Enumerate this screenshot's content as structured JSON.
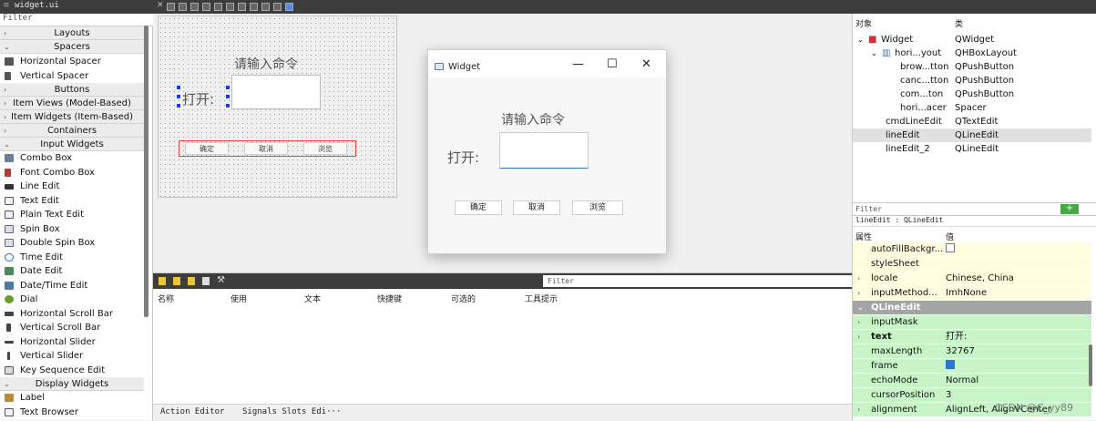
{
  "topbar": {
    "file": "widget.ui"
  },
  "left": {
    "filter": "Filter",
    "categories": {
      "layouts": "Layouts",
      "spacers": "Spacers",
      "buttons": "Buttons",
      "item_views": "Item Views (Model-Based)",
      "item_widgets": "Item Widgets (Item-Based)",
      "containers": "Containers",
      "input_widgets": "Input Widgets",
      "display_widgets": "Display Widgets"
    },
    "spacers": [
      "Horizontal Spacer",
      "Vertical Spacer"
    ],
    "input": [
      "Combo Box",
      "Font Combo Box",
      "Line Edit",
      "Text Edit",
      "Plain Text Edit",
      "Spin Box",
      "Double Spin Box",
      "Time Edit",
      "Date Edit",
      "Date/Time Edit",
      "Dial",
      "Horizontal Scroll Bar",
      "Vertical Scroll Bar",
      "Horizontal Slider",
      "Vertical Slider",
      "Key Sequence Edit"
    ],
    "display": [
      "Label",
      "Text Browser"
    ]
  },
  "form": {
    "title": "请输入命令",
    "label": "打开:",
    "buttons": [
      "确定",
      "取消",
      "浏览"
    ]
  },
  "preview": {
    "window_title": "Widget",
    "min": "—",
    "max": "☐",
    "close": "✕",
    "title": "请输入命令",
    "label": "打开:",
    "buttons": [
      "确定",
      "取消",
      "浏览"
    ]
  },
  "bottom": {
    "filter": "Filter",
    "columns": [
      "名称",
      "使用",
      "文本",
      "快捷键",
      "可选的",
      "工具提示"
    ],
    "tabs": [
      "Action Editor",
      "Signals Slots Edi···"
    ]
  },
  "object_inspector": {
    "headers": {
      "object": "对象",
      "class": "类"
    },
    "rows": [
      {
        "name": "Widget",
        "class": "QWidget"
      },
      {
        "name": "hori...yout",
        "class": "QHBoxLayout"
      },
      {
        "name": "brow...tton",
        "class": "QPushButton"
      },
      {
        "name": "canc...tton",
        "class": "QPushButton"
      },
      {
        "name": "com...ton",
        "class": "QPushButton"
      },
      {
        "name": "hori...acer",
        "class": "Spacer"
      },
      {
        "name": "cmdLineEdit",
        "class": "QTextEdit"
      },
      {
        "name": "lineEdit",
        "class": "QLineEdit"
      },
      {
        "name": "lineEdit_2",
        "class": "QLineEdit"
      }
    ]
  },
  "property_editor": {
    "filter": "Filter",
    "subtitle": "lineEdit : QLineEdit",
    "headers": {
      "property": "属性",
      "value": "值"
    },
    "rows": [
      {
        "name": "autoFillBackgr...",
        "value": "",
        "kind": "check"
      },
      {
        "name": "styleSheet",
        "value": ""
      },
      {
        "name": "locale",
        "value": "Chinese, China"
      },
      {
        "name": "inputMethod...",
        "value": "ImhNone"
      },
      {
        "name": "QLineEdit",
        "value": ""
      },
      {
        "name": "inputMask",
        "value": ""
      },
      {
        "name": "text",
        "value": "打开:"
      },
      {
        "name": "maxLength",
        "value": "32767"
      },
      {
        "name": "frame",
        "value": "",
        "kind": "checked"
      },
      {
        "name": "echoMode",
        "value": "Normal"
      },
      {
        "name": "cursorPosition",
        "value": "3"
      },
      {
        "name": "alignment",
        "value": "AlignLeft, AlignVCenter"
      }
    ]
  },
  "watermark": "CSDN @C_yy89"
}
